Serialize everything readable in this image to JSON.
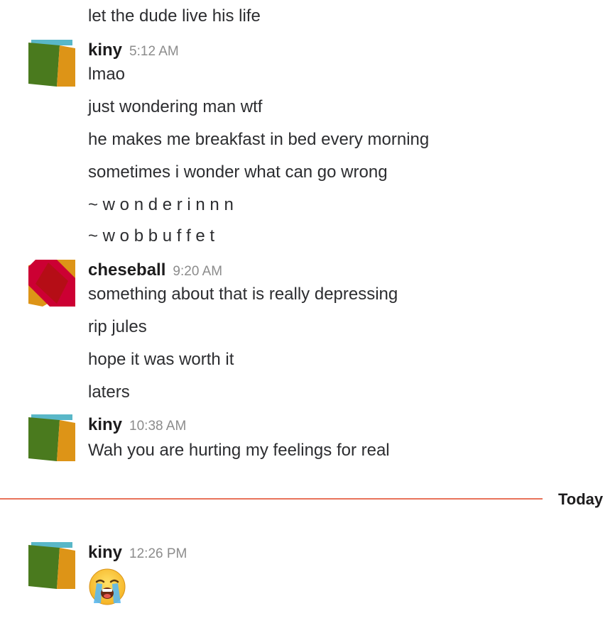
{
  "messages": {
    "prev_line": "let the dude live his life",
    "group1": {
      "author": "kiny",
      "time": "5:12 AM",
      "lines": [
        "lmao",
        "just wondering man wtf",
        "he makes me breakfast in bed every morning",
        "sometimes i wonder what can go wrong",
        "~ w o n d e r i n n n",
        "~ w o b b u f f e t"
      ]
    },
    "group2": {
      "author": "cheseball",
      "time": "9:20 AM",
      "lines": [
        "something about that is really depressing",
        "rip jules",
        "hope it was worth it",
        "laters"
      ]
    },
    "group3": {
      "author": "kiny",
      "time": "10:38 AM",
      "lines": [
        "Wah you are hurting my feelings for real"
      ]
    },
    "group4": {
      "author": "kiny",
      "time": "12:26 PM",
      "emoji": "loudly-crying-face"
    }
  },
  "divider": {
    "label": "Today",
    "color": "#e8735a"
  },
  "colors": {
    "kiny_avatar": [
      "#59b7c8",
      "#4a7a1e",
      "#dd9417"
    ],
    "cheseball_avatar": [
      "#dd9417",
      "#cc0033",
      "#ffffff"
    ]
  }
}
